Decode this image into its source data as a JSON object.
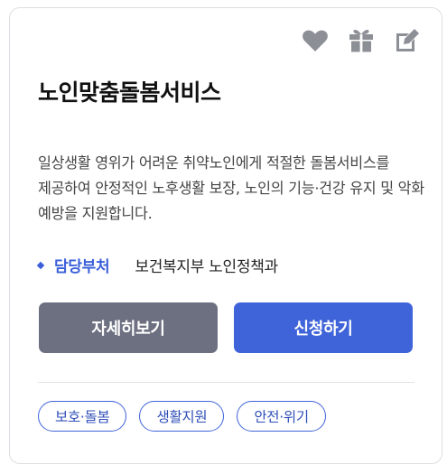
{
  "icons": {
    "favorite": "heart-icon",
    "gift": "gift-icon",
    "edit": "edit-icon",
    "color": "#8d8f96"
  },
  "service": {
    "title": "노인맞춤돌봄서비스",
    "description": "일상생활 영위가 어려운 취약노인에게 적절한 돌봄서비스를 제공하여 안정적인 노후생활 보장, 노인의 기능·건강 유지 및 악화 예방을 지원합니다.",
    "department_label": "담당부처",
    "department_value": "보건복지부 노인정책과"
  },
  "buttons": {
    "detail_label": "자세히보기",
    "apply_label": "신청하기"
  },
  "tags": [
    "보호·돌봄",
    "생활지원",
    "안전·위기"
  ],
  "colors": {
    "accent": "#3f63d9",
    "secondary_button": "#6d7081",
    "border": "#dcdde2"
  }
}
